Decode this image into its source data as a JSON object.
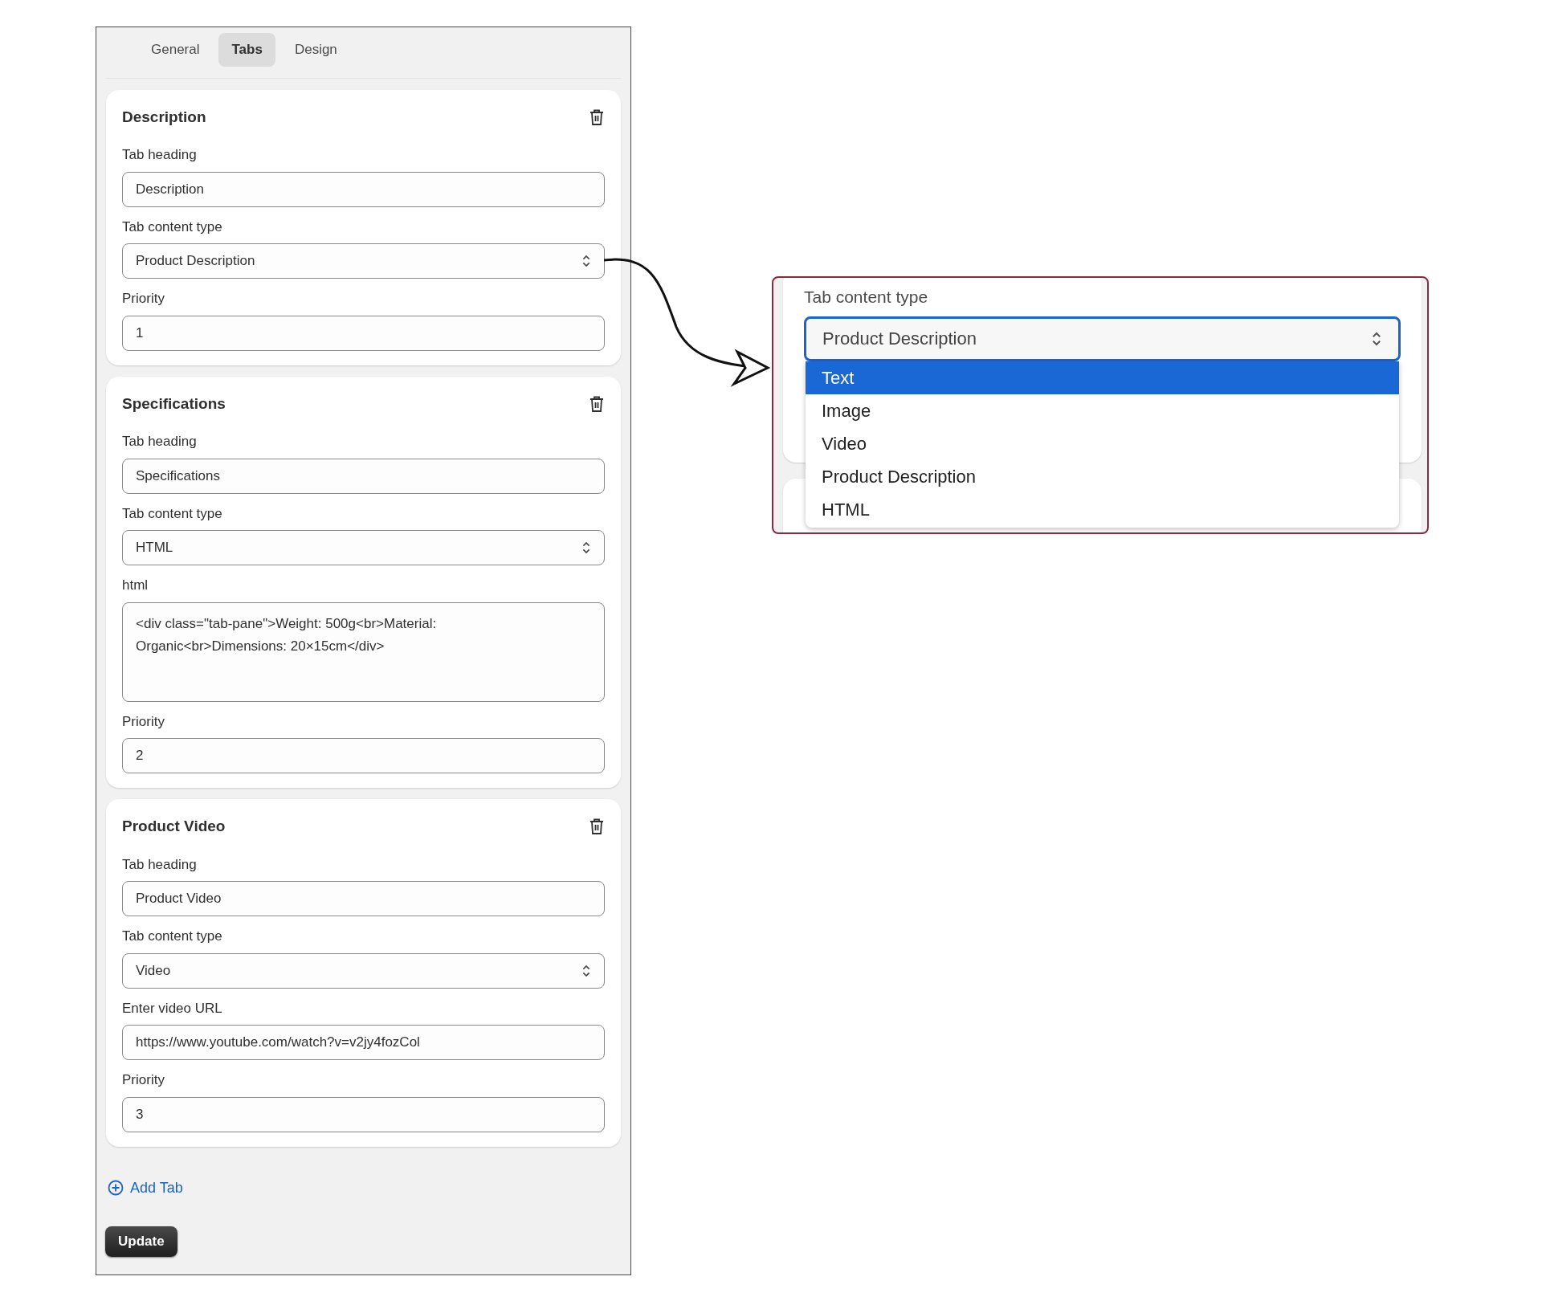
{
  "tabs": [
    {
      "label": "General",
      "selected": false
    },
    {
      "label": "Tabs",
      "selected": true
    },
    {
      "label": "Design",
      "selected": false
    }
  ],
  "cards": [
    {
      "title": "Description",
      "fields": [
        {
          "kind": "input",
          "label": "Tab heading",
          "value": "Description"
        },
        {
          "kind": "select",
          "label": "Tab content type",
          "value": "Product Description"
        },
        {
          "kind": "input",
          "label": "Priority",
          "value": "1"
        }
      ]
    },
    {
      "title": "Specifications",
      "fields": [
        {
          "kind": "input",
          "label": "Tab heading",
          "value": "Specifications"
        },
        {
          "kind": "select",
          "label": "Tab content type",
          "value": "HTML"
        },
        {
          "kind": "textarea",
          "label": "html",
          "value": "<div class=\"tab-pane\">Weight: 500g<br>Material: Organic<br>Dimensions: 20×15cm</div>"
        },
        {
          "kind": "input",
          "label": "Priority",
          "value": "2"
        }
      ]
    },
    {
      "title": "Product Video",
      "fields": [
        {
          "kind": "input",
          "label": "Tab heading",
          "value": "Product Video"
        },
        {
          "kind": "select",
          "label": "Tab content type",
          "value": "Video"
        },
        {
          "kind": "input",
          "label": "Enter video URL",
          "value": "https://www.youtube.com/watch?v=v2jy4fozCol"
        },
        {
          "kind": "input",
          "label": "Priority",
          "value": "3"
        }
      ]
    }
  ],
  "add_tab": {
    "label": "Add Tab"
  },
  "update_button": {
    "label": "Update"
  },
  "callout": {
    "label": "Tab content type",
    "value": "Product Description",
    "options": [
      {
        "label": "Text",
        "highlighted": true
      },
      {
        "label": "Image",
        "highlighted": false
      },
      {
        "label": "Video",
        "highlighted": false
      },
      {
        "label": "Product Description",
        "highlighted": false
      },
      {
        "label": "HTML",
        "highlighted": false
      }
    ]
  }
}
